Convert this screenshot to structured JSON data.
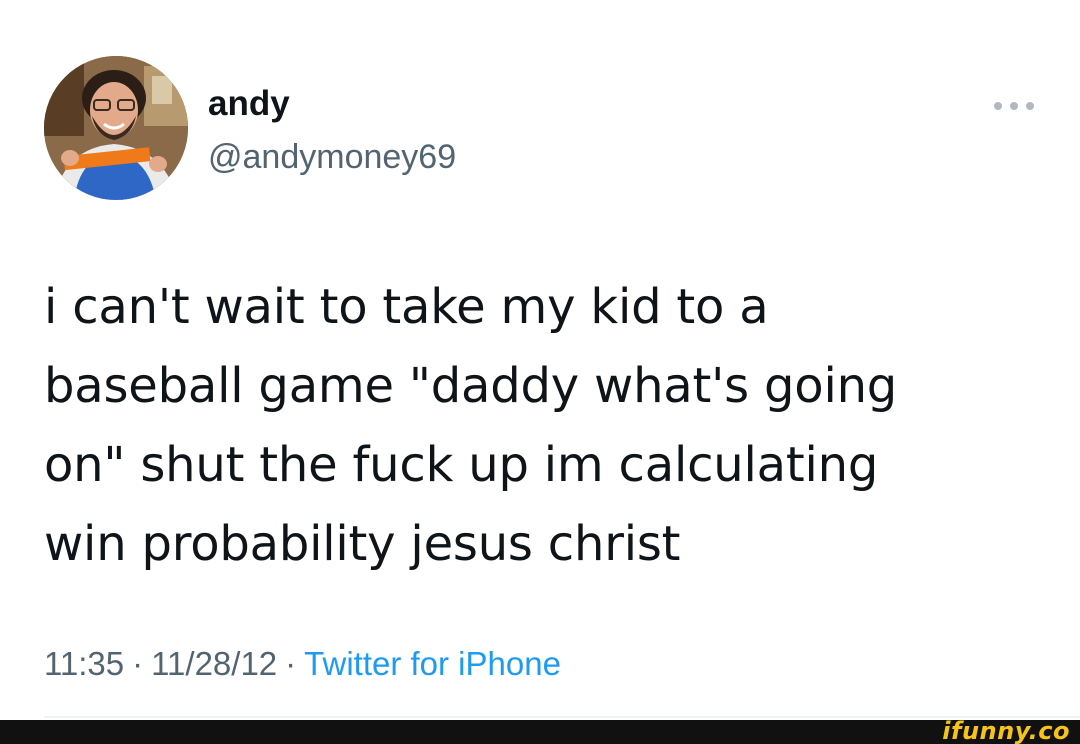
{
  "tweet": {
    "author": {
      "display_name": "andy",
      "handle": "@andymoney69",
      "avatar_icon": "user-avatar-photo"
    },
    "more_icon": "more-horizontal-icon",
    "text_lines": [
      "i can't wait to take my kid to a",
      "baseball game \"daddy what's going",
      "on\" shut the fuck up im calculating",
      "win probability jesus christ"
    ],
    "meta": {
      "time": "11:35",
      "separator": "·",
      "date": "11/28/12",
      "source": "Twitter for iPhone"
    }
  },
  "watermark": {
    "text": "ifunny.co"
  },
  "colors": {
    "text_primary": "#0f1419",
    "text_secondary": "#536471",
    "link": "#1d9bf0",
    "divider": "#eff3f4",
    "watermark_bar": "#111111",
    "watermark_text": "#f6c416"
  }
}
